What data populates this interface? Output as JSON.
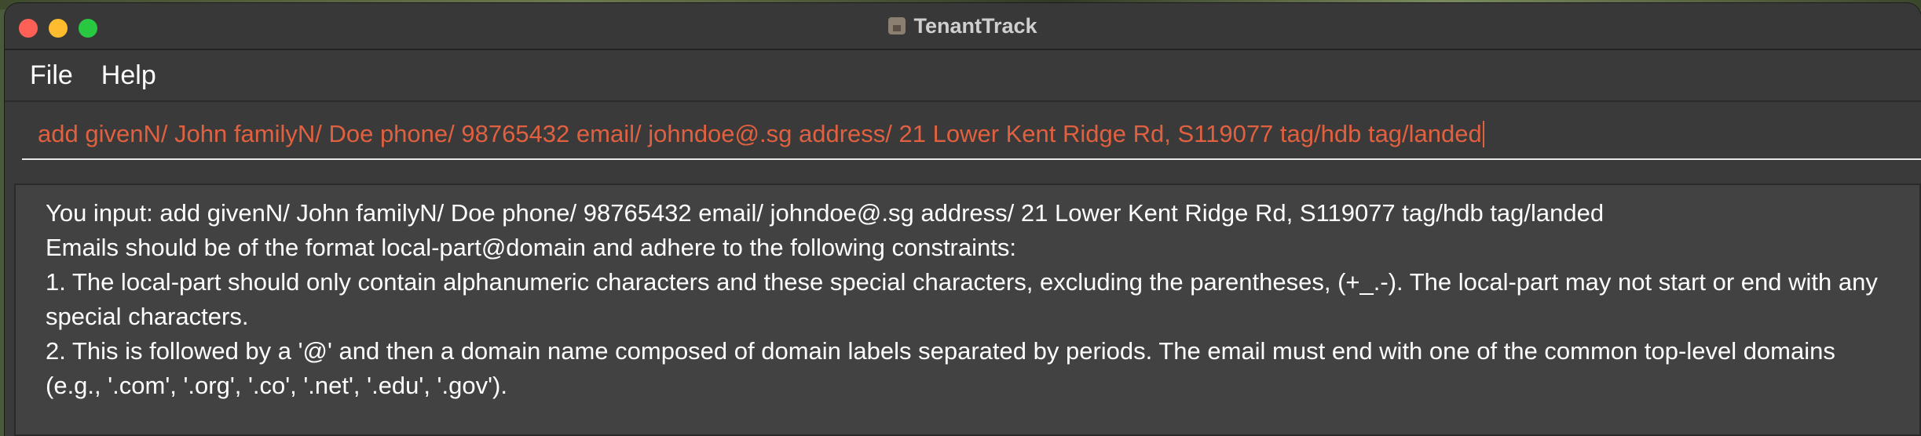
{
  "window": {
    "title": "TenantTrack"
  },
  "menu": {
    "items": [
      "File",
      "Help"
    ]
  },
  "command": {
    "value": "add givenN/ John familyN/ Doe phone/ 98765432 email/ johndoe@.sg address/ 21 Lower Kent Ridge Rd, S119077 tag/hdb tag/landed"
  },
  "result": {
    "lines": [
      "You input: add givenN/ John familyN/ Doe phone/ 98765432 email/ johndoe@.sg address/ 21 Lower Kent Ridge Rd, S119077 tag/hdb tag/landed",
      "Emails should be of the format local-part@domain and adhere to the following constraints:",
      "1. The local-part should only contain alphanumeric characters and these special characters, excluding the parentheses, (+_.-). The local-part may not start or end with any special characters.",
      "2. This is followed by a '@' and then a domain name composed of domain labels separated by periods. The email must end with one of the common top-level domains (e.g., '.com', '.org', '.co', '.net', '.edu', '.gov')."
    ]
  },
  "colors": {
    "command_text": "#e0603f",
    "window_bg": "#3a3a3a",
    "result_bg": "#424242"
  }
}
